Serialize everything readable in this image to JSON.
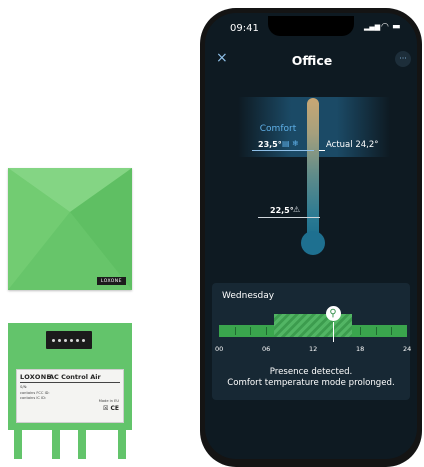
{
  "device_top": {
    "logo": "LOXONE"
  },
  "device_bottom": {
    "brand": "LOXONE",
    "product": "AC Control Air",
    "lines": [
      "S/N:",
      "contains FCC ID:",
      "contains IC ID:"
    ],
    "made_in": "Made in EU",
    "marks": "☒ CE"
  },
  "phone": {
    "status": {
      "time": "09:41",
      "signal": "▂▄▆",
      "wifi": "◠",
      "battery": "▬"
    },
    "nav": {
      "back_icon": "close-icon",
      "back_glyph": "×",
      "title": "Office",
      "menu_icon": "more-icon",
      "menu_glyph": "···"
    },
    "thermostat": {
      "mode_label": "Comfort",
      "comfort_setpoint": "23,5°",
      "comfort_icons": "▤ ❄",
      "actual_label": "Actual 24,2°",
      "eco_setpoint": "22,5°",
      "eco_icon": "⚠",
      "level_fraction": 0.62
    },
    "schedule": {
      "day": "Wednesday",
      "ticks": [
        "00",
        "06",
        "12",
        "18",
        "24"
      ],
      "comfort_from_hour": 7,
      "comfort_to_hour": 17,
      "now_hour": 14.5,
      "now_icon": "person-icon",
      "now_glyph": "⚲",
      "message_line1": "Presence detected.",
      "message_line2": "Comfort temperature mode prolonged."
    }
  },
  "colors": {
    "device_green": "#6cc96c",
    "accent_blue": "#5fb0e8",
    "schedule_green": "#3aa54d"
  }
}
